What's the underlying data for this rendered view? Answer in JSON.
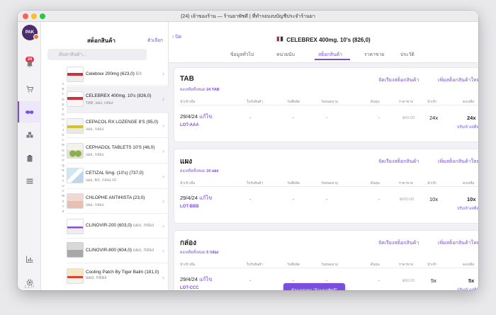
{
  "window": {
    "title": "(24) เจ้าของร้าน — ร้านยาพัชดี | ที่ทำรอบงบบัญชีประจำร้านยา"
  },
  "rail": {
    "avatar_text": "PAK",
    "notification_count": "24",
    "version": "1.1.77"
  },
  "sidebar": {
    "title": "สต็อกสินค้า",
    "select_label": "ตัวเลือก",
    "search_placeholder": "ค้นหาสินค้า...",
    "alphabet": [
      "A",
      "B",
      "C",
      "D",
      "E",
      "F",
      "G",
      "H",
      "I",
      "J",
      "K",
      "L",
      "M",
      "N",
      "O",
      "P",
      "Q",
      "R",
      "S",
      "T",
      "U",
      "V",
      "W",
      "X",
      "Y",
      "Z"
    ],
    "items": [
      {
        "name": "Celebrex 200mg (623,0)",
        "inline_sub": "BX",
        "sub": ""
      },
      {
        "name": "CELEBREX 400mg. 10's (826,0)",
        "inline_sub": "",
        "sub": "TAB, แผง, กล่อง"
      },
      {
        "name": "CEPACOL RX LOZENGE 8'S (95,0)",
        "inline_sub": "",
        "sub": "แผง, กล่อง"
      },
      {
        "name": "CEPHADOL TABLETS 10'S (46,0)",
        "inline_sub": "",
        "sub": "แผง, กล่อง"
      },
      {
        "name": "CETIZAL 5mg. (10's) (737,0)",
        "inline_sub": "",
        "sub": "แผง, BX, กล่อง 10"
      },
      {
        "name": "CHLOPHE ANTIHISTA (23,0)",
        "inline_sub": "",
        "sub": "แผง, กล่อง"
      },
      {
        "name": "CLINOVIR-200 (603,0)",
        "inline_sub": "แผง, กล่อง",
        "sub": ""
      },
      {
        "name": "CLINOVIR-800 (604,0)",
        "inline_sub": "แผง, กล่อง",
        "sub": ""
      },
      {
        "name": "Cooling Patch By Tiger Balm (181,0)",
        "inline_sub": "แผง, กล่อง",
        "sub": ""
      }
    ]
  },
  "main": {
    "back_label": "ปิด",
    "product_title": "CELEBREX 400mg. 10's (826,0)",
    "tabs": [
      {
        "label": "ข้อมูลทั่วไป"
      },
      {
        "label": "หน่วยนับ"
      },
      {
        "label": "สต็อกสินค้า"
      },
      {
        "label": "ราคาขาย"
      },
      {
        "label": "ประวัติ"
      }
    ],
    "columns": [
      "นำเข้าเมื่อ",
      "ใบรับสินค้า",
      "วันที่ผลิต",
      "วันหมดอายุ",
      "ต้นทุน",
      "ราคาขาย",
      "นำเข้า",
      "คงเหลือ"
    ],
    "manage_label": "จัดเรียงสต็อกสินค้า",
    "add_label": "เพิ่มสต็อกสินค้าใหม่",
    "edit_label": "แก้ไข",
    "adjust_label": "ปรับ/ล้างสต็อก",
    "sections": [
      {
        "unit": "TAB",
        "remain_text": "คงเหลือทั้งหมด",
        "remain_value": "24 TAB",
        "date": "29/4/24",
        "lot": "LOT-AAA",
        "receipt": "-",
        "mfg": "-",
        "exp": "-",
        "cost": "-",
        "price": "฿60.00",
        "imported": "24x",
        "remaining": "24x"
      },
      {
        "unit": "แผง",
        "remain_text": "คงเหลือทั้งหมด",
        "remain_value": "10 แผง",
        "date": "29/4/24",
        "lot": "LOT-BBB",
        "receipt": "-",
        "mfg": "-",
        "exp": "-",
        "cost": "-",
        "price": "฿650.00",
        "imported": "10x",
        "remaining": "10x"
      },
      {
        "unit": "กล่อง",
        "remain_text": "คงเหลือทั้งหมด",
        "remain_value": "5 กล่อง",
        "date": "29/4/24",
        "lot": "LOT-CCC",
        "receipt": "-",
        "mfg": "-",
        "exp": "-",
        "cost": "-",
        "price": "฿60.00",
        "imported": "5x",
        "remaining": "5x"
      }
    ]
  },
  "toast": {
    "label": "ข้อมูลสาขา \"ร้านยาพัชดี\""
  },
  "colors": {
    "accent": "#7a4fe0",
    "badge": "#e5364b"
  }
}
